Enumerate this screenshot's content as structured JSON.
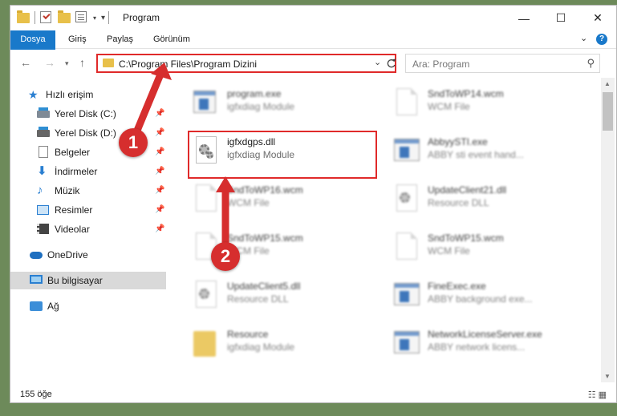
{
  "window": {
    "title": "Program"
  },
  "ribbon": {
    "tabs": [
      "Dosya",
      "Giriş",
      "Paylaş",
      "Görünüm"
    ]
  },
  "address": {
    "path": "C:\\Program Files\\Program Dizini"
  },
  "search": {
    "placeholder": "Ara: Program"
  },
  "sidebar": {
    "quick_access": "Hızlı erişim",
    "items": [
      "Yerel Disk (C:)",
      "Yerel Disk (D:)",
      "Belgeler",
      "İndirmeler",
      "Müzik",
      "Resimler",
      "Videolar"
    ],
    "onedrive": "OneDrive",
    "this_pc": "Bu bilgisayar",
    "network": "Ağ"
  },
  "files": {
    "left": [
      {
        "name": "program.exe",
        "desc": "igfxdiag Module"
      },
      {
        "name": "igfxdgps.dll",
        "desc": "igfxdiag Module"
      },
      {
        "name": "SndToWP16.wcm",
        "desc": "WCM File"
      },
      {
        "name": "SndToWP15.wcm",
        "desc": "WCM File"
      },
      {
        "name": "UpdateClient5.dll",
        "desc": "Resource DLL"
      },
      {
        "name": "Resource",
        "desc": "igfxdiag Module"
      }
    ],
    "right": [
      {
        "name": "SndToWP14.wcm",
        "desc": "WCM File"
      },
      {
        "name": "AbbyySTI.exe",
        "desc": "ABBY sti event hand..."
      },
      {
        "name": "UpdateClient21.dll",
        "desc": "Resource DLL"
      },
      {
        "name": "SndToWP15.wcm",
        "desc": "WCM File"
      },
      {
        "name": "FineExec.exe",
        "desc": "ABBY background exe..."
      },
      {
        "name": "NetworkLicenseServer.exe",
        "desc": "ABBY network licens..."
      }
    ]
  },
  "status": {
    "count": "155 öğe"
  },
  "annotations": {
    "step1": "1",
    "step2": "2",
    "color": "#d62e2e"
  }
}
